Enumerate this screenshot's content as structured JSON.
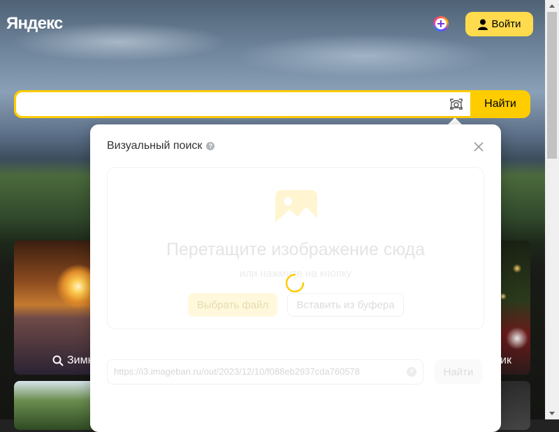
{
  "header": {
    "logo": "Яндекс",
    "login_label": "Войти"
  },
  "search": {
    "value": "",
    "button_label": "Найти"
  },
  "tiles": {
    "left_top_label": "Зимн",
    "right_top_label": "ик"
  },
  "modal": {
    "title": "Визуальный поиск",
    "drop_title": "Перетащите изображение сюда",
    "drop_subtitle": "или нажмите на кнопку",
    "choose_file_label": "Выбрать файл",
    "paste_label": "Вставить из буфера",
    "url_value": "https://i3.imageban.ru/out/2023/12/10/f088eb2937cda760578",
    "url_find_label": "Найти"
  },
  "colors": {
    "accent": "#ffcc00",
    "login_bg": "#ffdb4d"
  }
}
